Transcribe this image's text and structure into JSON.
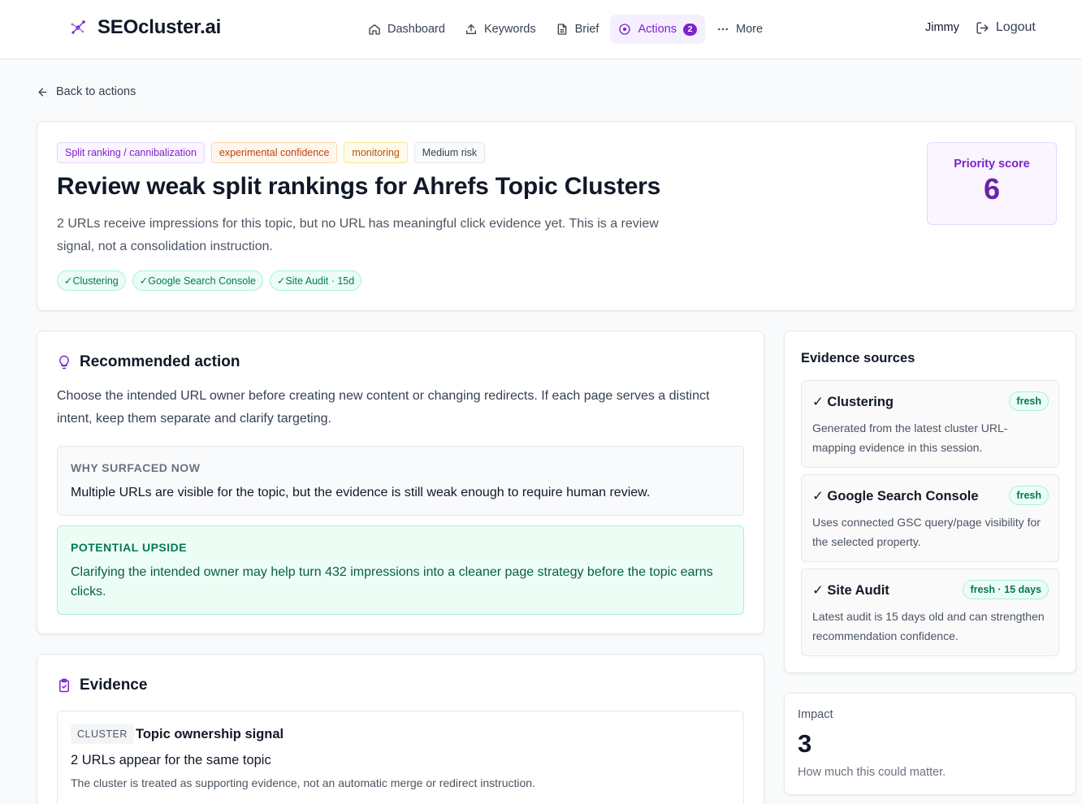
{
  "app": {
    "name": "SEOcluster.ai"
  },
  "nav": {
    "items": [
      {
        "label": "Dashboard",
        "icon": "home-icon"
      },
      {
        "label": "Keywords",
        "icon": "upload-icon"
      },
      {
        "label": "Brief",
        "icon": "document-icon"
      },
      {
        "label": "Actions",
        "icon": "target-icon",
        "count": "2"
      },
      {
        "label": "More",
        "icon": "more-icon"
      }
    ],
    "active": "Actions",
    "user": "Jimmy",
    "logout": "Logout"
  },
  "back_link": "Back to actions",
  "hero": {
    "tags": [
      "Split ranking / cannibalization",
      "experimental confidence",
      "monitoring",
      "Medium risk"
    ],
    "title": "Review weak split rankings for Ahrefs Topic Clusters",
    "description": "2 URLs receive impressions for this topic, but no URL has meaningful click evidence yet. This is a review signal, not a consolidation instruction.",
    "sources": [
      "✓Clustering",
      "✓Google Search Console",
      "✓Site Audit · 15d"
    ],
    "priority_label": "Priority score",
    "priority_value": "6"
  },
  "recommended": {
    "heading": "Recommended action",
    "text": "Choose the intended URL owner before creating new content or changing redirects. If each page serves a distinct intent, keep them separate and clarify targeting.",
    "why_label": "WHY SURFACED NOW",
    "why_text": "Multiple URLs are visible for the topic, but the evidence is still weak enough to require human review.",
    "upside_label": "POTENTIAL UPSIDE",
    "upside_text": "Clarifying the intended owner may help turn 432 impressions into a cleaner page strategy before the topic earns clicks."
  },
  "evidence": {
    "heading": "Evidence",
    "items": [
      {
        "badge": "CLUSTER",
        "title": "Topic ownership signal",
        "claim": "2 URLs appear for the same topic",
        "note": "The cluster is treated as supporting evidence, not an automatic merge or redirect instruction."
      }
    ]
  },
  "evidence_sources": {
    "heading": "Evidence sources",
    "items": [
      {
        "title": "✓ Clustering",
        "badge": "fresh",
        "text": "Generated from the latest cluster URL-mapping evidence in this session."
      },
      {
        "title": "✓ Google Search Console",
        "badge": "fresh",
        "text": "Uses connected GSC query/page visibility for the selected property."
      },
      {
        "title": "✓ Site Audit",
        "badge": "fresh · 15 days",
        "text": "Latest audit is 15 days old and can strengthen recommendation confidence."
      }
    ]
  },
  "impact": {
    "label": "Impact",
    "value": "3",
    "note": "How much this could matter."
  },
  "colors": {
    "accent": "#7e22ce",
    "success": "#047857",
    "warning": "#c2410c"
  }
}
